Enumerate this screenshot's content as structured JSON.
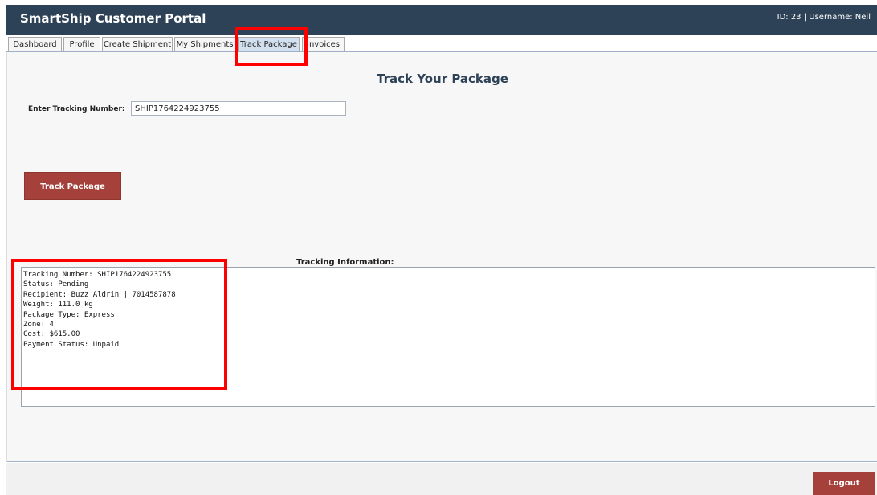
{
  "header": {
    "title": "SmartShip Customer Portal",
    "user_info": "ID: 23 | Username: Neil"
  },
  "tabs": [
    {
      "label": "Dashboard"
    },
    {
      "label": "Profile"
    },
    {
      "label": "Create Shipment"
    },
    {
      "label": "My Shipments"
    },
    {
      "label": "Track Package",
      "active": true
    },
    {
      "label": "Invoices"
    }
  ],
  "track": {
    "title": "Track Your Package",
    "tracking_label": "Enter Tracking Number:",
    "tracking_value": "SHIP1764224923755",
    "button_label": "Track Package",
    "info_label": "Tracking Information:",
    "info_lines": [
      "Tracking Number: SHIP1764224923755",
      "Status: Pending",
      "Recipient: Buzz Aldrin | 7014587878",
      "Weight: 111.0 kg",
      "Package Type: Express",
      "Zone: 4",
      "Cost: $615.00",
      "Payment Status: Unpaid"
    ]
  },
  "footer": {
    "logout_label": "Logout"
  },
  "colors": {
    "header_bg": "#2e4257",
    "accent_button": "#a5413a",
    "active_tab": "#d2e0ef",
    "annotation": "#ff0000"
  }
}
